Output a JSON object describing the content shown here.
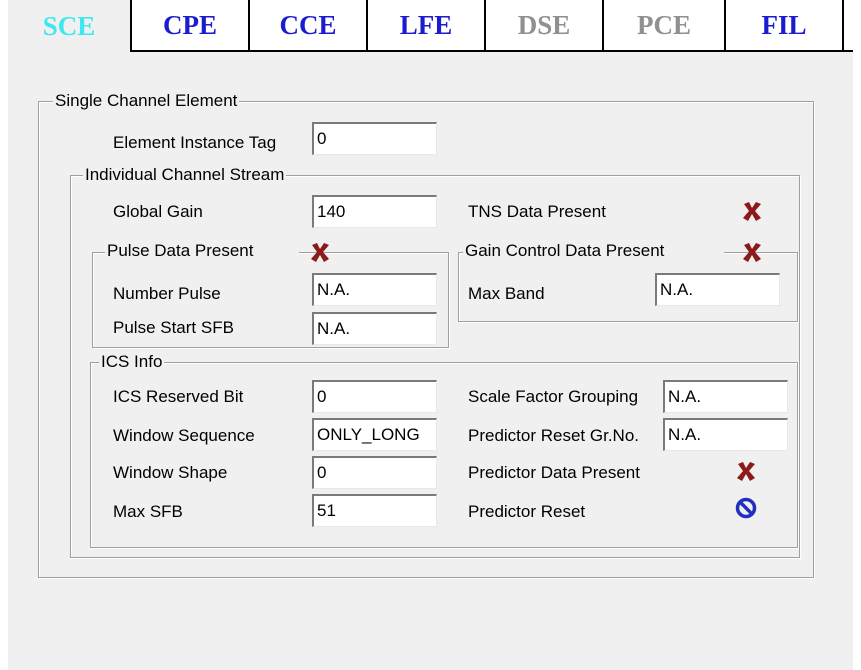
{
  "tabs": [
    {
      "label": "SCE",
      "state": "active"
    },
    {
      "label": "CPE",
      "state": "normal"
    },
    {
      "label": "CCE",
      "state": "normal"
    },
    {
      "label": "LFE",
      "state": "normal"
    },
    {
      "label": "DSE",
      "state": "disabled"
    },
    {
      "label": "PCE",
      "state": "disabled"
    },
    {
      "label": "FIL",
      "state": "normal"
    }
  ],
  "sce": {
    "title": "Single Channel Element",
    "element_instance_tag": {
      "label": "Element Instance Tag",
      "value": "0"
    },
    "ics": {
      "title": "Individual Channel Stream",
      "global_gain": {
        "label": "Global Gain",
        "value": "140"
      },
      "tns_data_present": {
        "label": "TNS Data Present",
        "icon": "x-icon"
      },
      "pulse": {
        "title": "Pulse Data Present",
        "icon": "x-icon",
        "number_pulse": {
          "label": "Number Pulse",
          "value": "N.A."
        },
        "pulse_start_sfb": {
          "label": "Pulse Start SFB",
          "value": "N.A."
        }
      },
      "gain_control": {
        "title": "Gain Control Data Present",
        "icon": "x-icon",
        "max_band": {
          "label": "Max Band",
          "value": "N.A."
        }
      },
      "ics_info": {
        "title": "ICS Info",
        "ics_reserved_bit": {
          "label": "ICS Reserved Bit",
          "value": "0"
        },
        "window_sequence": {
          "label": "Window Sequence",
          "value": "ONLY_LONG"
        },
        "window_shape": {
          "label": "Window Shape",
          "value": "0"
        },
        "max_sfb": {
          "label": "Max SFB",
          "value": "51"
        },
        "scale_factor_grouping": {
          "label": "Scale Factor Grouping",
          "value": "N.A."
        },
        "predictor_reset_grno": {
          "label": "Predictor Reset Gr.No.",
          "value": "N.A."
        },
        "predictor_data_present": {
          "label": "Predictor Data Present",
          "icon": "x-icon"
        },
        "predictor_reset": {
          "label": "Predictor Reset",
          "icon": "no-entry-icon"
        }
      }
    }
  },
  "colors": {
    "tab_text": "#1c1ccf",
    "tab_active_text": "#3ee8f0",
    "tab_disabled_text": "#909090",
    "x_icon": "#8b1a1a",
    "no_icon": "#1f2fbf"
  }
}
